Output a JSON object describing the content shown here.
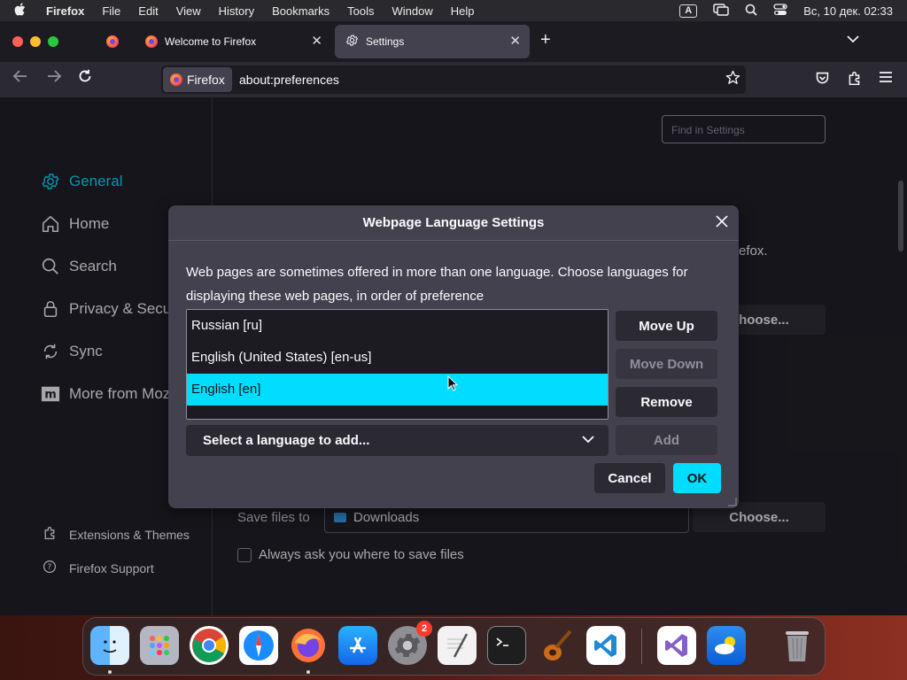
{
  "menubar": {
    "app": "Firefox",
    "items": [
      "File",
      "Edit",
      "View",
      "History",
      "Bookmarks",
      "Tools",
      "Window",
      "Help"
    ],
    "keyboard_indicator": "A",
    "clock": "Вс, 10 дек.  02:33"
  },
  "tabs": [
    {
      "title": "Welcome to Firefox"
    },
    {
      "title": "Settings"
    }
  ],
  "urlbar": {
    "identity": "Firefox",
    "url": "about:preferences"
  },
  "settings": {
    "find_placeholder": "Find in Settings",
    "categories": [
      "General",
      "Home",
      "Search",
      "Privacy & Security",
      "Sync",
      "More from Mozilla"
    ],
    "footer": [
      "Extensions & Themes",
      "Firefox Support"
    ],
    "bg_partial_text": "efox.",
    "choose_label": "Choose...",
    "save_files_label": "Save files to",
    "downloads_folder": "Downloads",
    "always_ask_label": "Always ask you where to save files"
  },
  "dialog": {
    "title": "Webpage Language Settings",
    "description": "Web pages are sometimes offered in more than one language. Choose languages for displaying these web pages, in order of preference",
    "languages": [
      "Russian [ru]",
      "English (United States) [en-us]",
      "English [en]"
    ],
    "selected_index": 2,
    "move_up": "Move Up",
    "move_down": "Move Down",
    "remove": "Remove",
    "select_placeholder": "Select a language to add...",
    "add": "Add",
    "cancel": "Cancel",
    "ok": "OK"
  },
  "dock": {
    "system_settings_badge": "2"
  },
  "colors": {
    "accent": "#00ddff",
    "dialog_bg": "#42414d",
    "page_bg": "#1c1b22"
  }
}
